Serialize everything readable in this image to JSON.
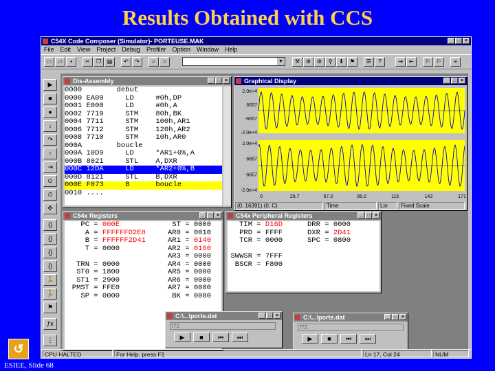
{
  "slide": {
    "title": "Results Obtained with CCS",
    "footer": "ESIEE, Slide 68",
    "logo_icon": "esiee-logo-icon"
  },
  "app": {
    "title": "C54X Code Composer (Simulator)- PORTEUSE.MAK",
    "menu": [
      "File",
      "Edit",
      "View",
      "Project",
      "Debug",
      "Profiler",
      "Option",
      "Window",
      "Help"
    ]
  },
  "disassembly": {
    "title": "Dis-Assembly",
    "rows": [
      "0000        debut",
      "0000 EA00     LD     #0h,DP",
      "0001 E000     LD     #0h,A",
      "0002 7719     STM    80h,BK",
      "0004 7711     STM    100h,AR1",
      "0006 7712     STM    120h,AR2",
      "0008 7710     STM    10h,AR0",
      "000A        boucle",
      "000A 10D9     LD     *AR1+0%,A",
      "000B 8021     STL    A,DXR",
      "000C 12DA     LD     *AR2+0%,B",
      "000D 8121     STL    B,DXR",
      "000E F073     B      boucle",
      "0010 ...."
    ],
    "selected_row": 10,
    "pc_row": 12
  },
  "graph": {
    "title": "Graphical Display",
    "top_ylabels": [
      "2.0e+4",
      "6657",
      "-6657",
      "-2.0e+4"
    ],
    "bottom_ylabels": [
      "2.0e+4",
      "6657",
      "-6657",
      "-2.0e+4"
    ],
    "xlabels": [
      "0",
      "28.7",
      "57.3",
      "86.0",
      "115",
      "143",
      "171"
    ],
    "status": [
      "(0, 16391) (0, C)",
      "Time",
      "Lin",
      "Fixed Scale"
    ],
    "plot_color": "#ffff00",
    "line_color": "#0000c0"
  },
  "cpu_registers": {
    "title": "C54x Registers",
    "left": [
      {
        "name": "PC",
        "value": "000E",
        "red": true
      },
      {
        "name": "A",
        "value": "FFFFFFD2E8",
        "red": true
      },
      {
        "name": "B",
        "value": "FFFFFF2D41",
        "red": true
      },
      {
        "name": "T",
        "value": "0000",
        "red": false
      },
      {
        "name": "",
        "value": "",
        "red": false
      },
      {
        "name": "TRN",
        "value": "0000",
        "red": false
      },
      {
        "name": "ST0",
        "value": "1800",
        "red": false
      },
      {
        "name": "ST1",
        "value": "2900",
        "red": false
      },
      {
        "name": "PMST",
        "value": "FFE0",
        "red": false
      },
      {
        "name": "SP",
        "value": "0000",
        "red": false
      }
    ],
    "right": [
      {
        "name": "ST",
        "value": "0000",
        "red": false
      },
      {
        "name": "AR0",
        "value": "0010",
        "red": false
      },
      {
        "name": "AR1",
        "value": "0140",
        "red": true
      },
      {
        "name": "AR2",
        "value": "0160",
        "red": true
      },
      {
        "name": "AR3",
        "value": "0000",
        "red": false
      },
      {
        "name": "AR4",
        "value": "0000",
        "red": false
      },
      {
        "name": "AR5",
        "value": "0000",
        "red": false
      },
      {
        "name": "AR6",
        "value": "0000",
        "red": false
      },
      {
        "name": "AR7",
        "value": "0000",
        "red": false
      },
      {
        "name": "BK",
        "value": "0080",
        "red": false
      }
    ]
  },
  "peripheral_registers": {
    "title": "C54x Peripheral Registers",
    "rows": [
      [
        {
          "name": "TIM",
          "value": "D16D",
          "red": true
        },
        {
          "name": "DRR",
          "value": "0000",
          "red": false
        }
      ],
      [
        {
          "name": "PRD",
          "value": "FFFF",
          "red": false
        },
        {
          "name": "DXR",
          "value": "2D41",
          "red": true
        }
      ],
      [
        {
          "name": "TCR",
          "value": "0000",
          "red": false
        },
        {
          "name": "SPC",
          "value": "0800",
          "red": false
        }
      ],
      [
        {
          "name": "",
          "value": "",
          "red": false
        },
        {
          "name": "",
          "value": "",
          "red": false
        }
      ],
      [
        {
          "name": "SWWSR",
          "value": "7FFF",
          "red": false
        },
        {
          "name": "",
          "value": "",
          "red": false
        }
      ],
      [
        {
          "name": "BSCR",
          "value": "F800",
          "red": false
        },
        {
          "name": "",
          "value": "",
          "red": false
        }
      ]
    ]
  },
  "file_players": [
    {
      "title": "C:\\...\\porte.dat",
      "field": "f72"
    },
    {
      "title": "C:\\...\\porte.dat",
      "field": "f72"
    }
  ],
  "statusbar": {
    "state": "CPU HALTED",
    "help": "For Help, press F1",
    "position": "Ln 17, Col 24",
    "mode": "NUM"
  }
}
